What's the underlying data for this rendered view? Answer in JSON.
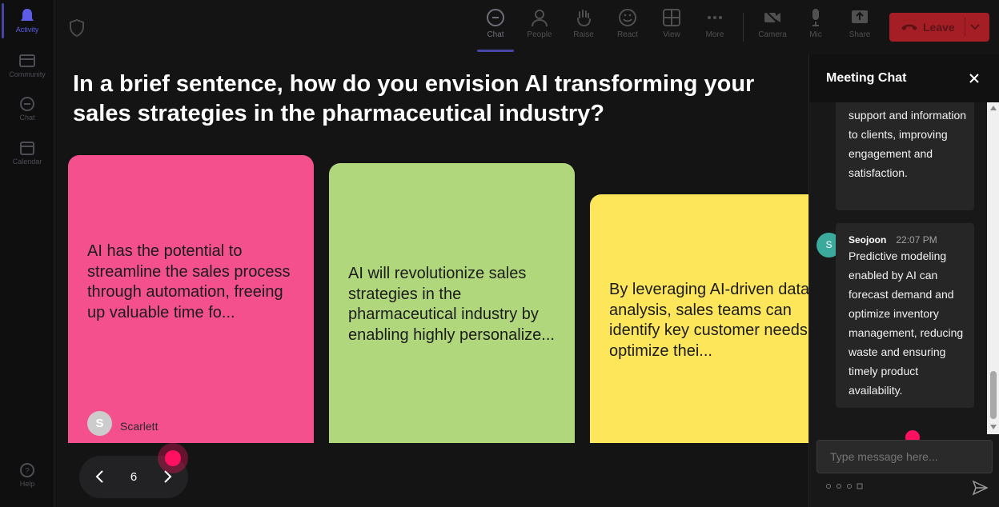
{
  "rail": {
    "items": [
      {
        "label": "Activity",
        "icon": "bell-icon",
        "active": true
      },
      {
        "label": "Community",
        "icon": "community-icon"
      },
      {
        "label": "Chat",
        "icon": "chat-icon"
      },
      {
        "label": "Calendar",
        "icon": "calendar-icon"
      }
    ],
    "help": {
      "label": "Help",
      "icon": "help-icon"
    }
  },
  "topbar": {
    "security_icon": "shield-icon",
    "controls": [
      {
        "label": "Chat",
        "icon": "chat-icon",
        "active": true
      },
      {
        "label": "People",
        "icon": "people-icon"
      },
      {
        "label": "Raise",
        "icon": "raise-hand-icon"
      },
      {
        "label": "React",
        "icon": "smile-icon"
      },
      {
        "label": "View",
        "icon": "grid-icon"
      },
      {
        "label": "More",
        "icon": "more-icon"
      },
      {
        "label": "Camera",
        "icon": "camera-off-icon"
      },
      {
        "label": "Mic",
        "icon": "mic-icon"
      },
      {
        "label": "Share",
        "icon": "share-icon"
      }
    ],
    "leave": {
      "label": "Leave",
      "color": "#a51e25"
    }
  },
  "stage": {
    "question": "In a brief sentence, how do you envision AI transforming your sales strategies in the pharmaceutical industry?",
    "cards": [
      {
        "text": "AI has the potential to streamline the sales process through automation, freeing up valuable time fo...",
        "color": "#f5508e",
        "author": "Scarlett",
        "author_initial": "S"
      },
      {
        "text": "AI will revolutionize sales strategies in the pharmaceutical industry by enabling highly personalize...",
        "color": "#b0d77c"
      },
      {
        "text": "By leveraging AI-driven data analysis, sales teams can identify key customer needs and optimize thei...",
        "color": "#fde659"
      }
    ],
    "pager": {
      "page": "6"
    }
  },
  "chat": {
    "title": "Meeting Chat",
    "messages": [
      {
        "text": "support and information to clients, improving engagement and satisfaction."
      },
      {
        "author": "Seojoon",
        "initial": "S",
        "time": "22:07 PM",
        "text": "Predictive modeling enabled by AI can forecast demand and optimize inventory management, reducing waste and ensuring timely product availability.",
        "avatar_color": "#3ba99c"
      }
    ],
    "input_placeholder": "Type message here..."
  },
  "colors": {
    "accent": "#5e5ce6",
    "cursor": "#ff1060"
  }
}
